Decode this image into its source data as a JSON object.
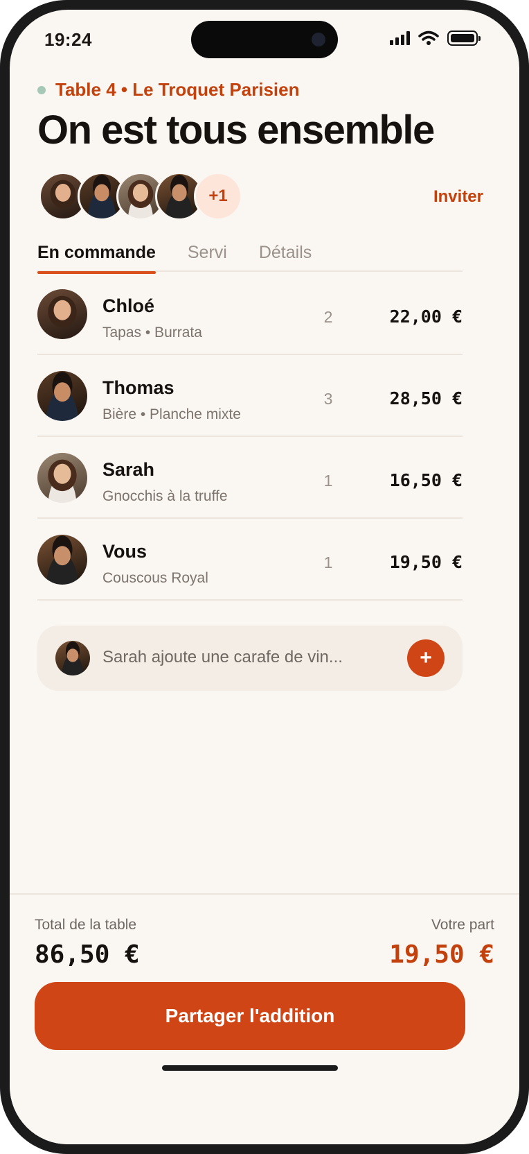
{
  "status_bar": {
    "time": "19:24"
  },
  "header": {
    "subtitle": "Table 4 • Le Troquet Parisien",
    "title": "On est tous ensemble",
    "extra_guests": "+1",
    "invite_label": "Inviter"
  },
  "tabs": [
    {
      "label": "En commande",
      "active": true
    },
    {
      "label": "Servi",
      "active": false
    },
    {
      "label": "Détails",
      "active": false
    }
  ],
  "orders": [
    {
      "name": "Chloé",
      "items": "Tapas • Burrata",
      "qty": "2",
      "price": "22,00 €"
    },
    {
      "name": "Thomas",
      "items": "Bière • Planche mixte",
      "qty": "3",
      "price": "28,50 €"
    },
    {
      "name": "Sarah",
      "items": "Gnocchis à la truffe",
      "qty": "1",
      "price": "16,50 €"
    },
    {
      "name": "Vous",
      "items": "Couscous Royal",
      "qty": "1",
      "price": "19,50 €"
    }
  ],
  "activity": {
    "text": "Sarah ajoute une carafe de vin...",
    "add_icon": "plus-icon",
    "add_symbol": "+"
  },
  "footer": {
    "total_label": "Total de la table",
    "total_value": "86,50 €",
    "share_label": "Votre part",
    "share_value": "19,50 €",
    "cta_label": "Partager l'addition"
  },
  "colors": {
    "accent": "#d04515",
    "accent_text": "#c2410c",
    "background": "#faf6f2",
    "live_dot": "#a6c8b6"
  }
}
